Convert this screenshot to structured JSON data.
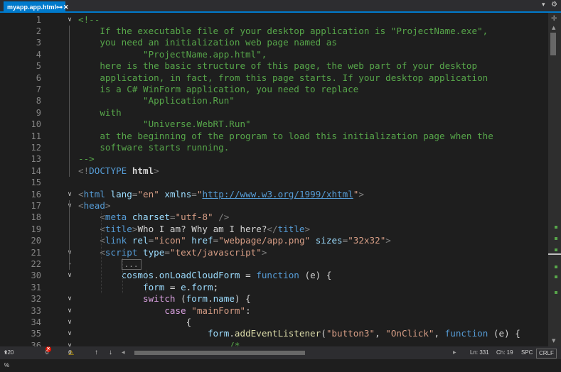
{
  "tab": {
    "title": "myapp.app.html",
    "pin_glyph": "⊶",
    "close_glyph": "✕"
  },
  "tabbar": {
    "dropdown_glyph": "▾",
    "settings_glyph": "⚙"
  },
  "editor": {
    "collapsed_placeholder": "...",
    "lines": [
      {
        "n": "1",
        "fold": "∨",
        "tokens": [
          {
            "t": "<!--",
            "c": "t-comment"
          }
        ]
      },
      {
        "n": "2",
        "tokens": [
          {
            "t": "    If the executable file of your desktop application is \"ProjectName.exe\",",
            "c": "t-comment"
          }
        ]
      },
      {
        "n": "3",
        "tokens": [
          {
            "t": "    you need an initialization web page named as",
            "c": "t-comment"
          }
        ]
      },
      {
        "n": "4",
        "tokens": [
          {
            "t": "            \"ProjectName.app.html\",",
            "c": "t-comment"
          }
        ]
      },
      {
        "n": "5",
        "tokens": [
          {
            "t": "    here is the basic structure of this page, the web part of your desktop",
            "c": "t-comment"
          }
        ]
      },
      {
        "n": "6",
        "tokens": [
          {
            "t": "    application, in fact, from this page starts. If your desktop application",
            "c": "t-comment"
          }
        ]
      },
      {
        "n": "7",
        "tokens": [
          {
            "t": "    is a C# WinForm application, you need to replace",
            "c": "t-comment"
          }
        ]
      },
      {
        "n": "8",
        "tokens": [
          {
            "t": "            \"Application.Run\"",
            "c": "t-comment"
          }
        ]
      },
      {
        "n": "9",
        "tokens": [
          {
            "t": "    with",
            "c": "t-comment"
          }
        ]
      },
      {
        "n": "10",
        "tokens": [
          {
            "t": "            \"Universe.WebRT.Run\"",
            "c": "t-comment"
          }
        ]
      },
      {
        "n": "11",
        "tokens": [
          {
            "t": "    at the beginning of the program to load this initialization page when the",
            "c": "t-comment"
          }
        ]
      },
      {
        "n": "12",
        "tokens": [
          {
            "t": "    software starts running.",
            "c": "t-comment"
          }
        ]
      },
      {
        "n": "13",
        "tokens": [
          {
            "t": "-->",
            "c": "t-comment"
          }
        ]
      },
      {
        "n": "14",
        "tokens": [
          {
            "t": "<!",
            "c": "t-punc"
          },
          {
            "t": "DOCTYPE",
            "c": "t-doctype"
          },
          {
            "t": " html",
            "c": "t-html"
          },
          {
            "t": ">",
            "c": "t-punc"
          }
        ]
      },
      {
        "n": "15",
        "tokens": []
      },
      {
        "n": "16",
        "fold": "∨",
        "tokens": [
          {
            "t": "<",
            "c": "t-punc"
          },
          {
            "t": "html",
            "c": "t-tag"
          },
          {
            "t": " lang",
            "c": "t-attr"
          },
          {
            "t": "=",
            "c": "t-punc"
          },
          {
            "t": "\"en\"",
            "c": "t-str"
          },
          {
            "t": " xmlns",
            "c": "t-attr"
          },
          {
            "t": "=",
            "c": "t-punc"
          },
          {
            "t": "\"",
            "c": "t-str"
          },
          {
            "t": "http://www.w3.org/1999/xhtml",
            "c": "t-url"
          },
          {
            "t": "\"",
            "c": "t-str"
          },
          {
            "t": ">",
            "c": "t-punc"
          }
        ]
      },
      {
        "n": "17",
        "fold": "∨",
        "tokens": [
          {
            "t": "<",
            "c": "t-punc"
          },
          {
            "t": "head",
            "c": "t-tag"
          },
          {
            "t": ">",
            "c": "t-punc"
          }
        ]
      },
      {
        "n": "18",
        "tokens": [
          {
            "t": "    <",
            "c": "t-punc"
          },
          {
            "t": "meta",
            "c": "t-tag"
          },
          {
            "t": " charset",
            "c": "t-attr"
          },
          {
            "t": "=",
            "c": "t-punc"
          },
          {
            "t": "\"utf-8\"",
            "c": "t-str"
          },
          {
            "t": " />",
            "c": "t-punc"
          }
        ]
      },
      {
        "n": "19",
        "tokens": [
          {
            "t": "    <",
            "c": "t-punc"
          },
          {
            "t": "title",
            "c": "t-tag"
          },
          {
            "t": ">",
            "c": "t-punc"
          },
          {
            "t": "Who I am? Why am I here?",
            "c": "t-txt"
          },
          {
            "t": "</",
            "c": "t-punc"
          },
          {
            "t": "title",
            "c": "t-tag"
          },
          {
            "t": ">",
            "c": "t-punc"
          }
        ]
      },
      {
        "n": "20",
        "tokens": [
          {
            "t": "    <",
            "c": "t-punc"
          },
          {
            "t": "link",
            "c": "t-tag"
          },
          {
            "t": " rel",
            "c": "t-attr"
          },
          {
            "t": "=",
            "c": "t-punc"
          },
          {
            "t": "\"icon\"",
            "c": "t-str"
          },
          {
            "t": " href",
            "c": "t-attr"
          },
          {
            "t": "=",
            "c": "t-punc"
          },
          {
            "t": "\"webpage/app.png\"",
            "c": "t-str"
          },
          {
            "t": " sizes",
            "c": "t-attr"
          },
          {
            "t": "=",
            "c": "t-punc"
          },
          {
            "t": "\"32x32\"",
            "c": "t-str"
          },
          {
            "t": ">",
            "c": "t-punc"
          }
        ]
      },
      {
        "n": "21",
        "fold": "∨",
        "tokens": [
          {
            "t": "    <",
            "c": "t-punc"
          },
          {
            "t": "script",
            "c": "t-tag"
          },
          {
            "t": " type",
            "c": "t-attr"
          },
          {
            "t": "=",
            "c": "t-punc"
          },
          {
            "t": "\"text/javascript\"",
            "c": "t-str"
          },
          {
            "t": ">",
            "c": "t-punc"
          }
        ]
      },
      {
        "n": "22",
        "fold": "›",
        "collapsed": true,
        "tokens": [
          {
            "t": "        ",
            "c": "t-txt"
          }
        ]
      },
      {
        "n": "30",
        "fold": "∨",
        "tokens": [
          {
            "t": "        cosmos",
            "c": "t-var"
          },
          {
            "t": ".",
            "c": "t-txt"
          },
          {
            "t": "onLoadCloudForm",
            "c": "t-var"
          },
          {
            "t": " = ",
            "c": "t-txt"
          },
          {
            "t": "function",
            "c": "t-kw"
          },
          {
            "t": " (e) {",
            "c": "t-txt"
          }
        ]
      },
      {
        "n": "31",
        "tokens": [
          {
            "t": "            form",
            "c": "t-var"
          },
          {
            "t": " = ",
            "c": "t-txt"
          },
          {
            "t": "e",
            "c": "t-var"
          },
          {
            "t": ".",
            "c": "t-txt"
          },
          {
            "t": "form",
            "c": "t-var"
          },
          {
            "t": ";",
            "c": "t-txt"
          }
        ]
      },
      {
        "n": "32",
        "fold": "∨",
        "tokens": [
          {
            "t": "            switch",
            "c": "t-ctrl"
          },
          {
            "t": " (",
            "c": "t-txt"
          },
          {
            "t": "form",
            "c": "t-var"
          },
          {
            "t": ".",
            "c": "t-txt"
          },
          {
            "t": "name",
            "c": "t-var"
          },
          {
            "t": ") {",
            "c": "t-txt"
          }
        ]
      },
      {
        "n": "33",
        "fold": "∨",
        "tokens": [
          {
            "t": "                case",
            "c": "t-ctrl"
          },
          {
            "t": " \"mainForm\"",
            "c": "t-str2"
          },
          {
            "t": ":",
            "c": "t-txt"
          }
        ]
      },
      {
        "n": "34",
        "fold": "∨",
        "tokens": [
          {
            "t": "                    {",
            "c": "t-txt"
          }
        ]
      },
      {
        "n": "35",
        "fold": "∨",
        "tokens": [
          {
            "t": "                        form",
            "c": "t-var"
          },
          {
            "t": ".",
            "c": "t-txt"
          },
          {
            "t": "addEventListener",
            "c": "t-fn"
          },
          {
            "t": "(",
            "c": "t-txt"
          },
          {
            "t": "\"button3\"",
            "c": "t-str2"
          },
          {
            "t": ", ",
            "c": "t-txt"
          },
          {
            "t": "\"OnClick\"",
            "c": "t-str2"
          },
          {
            "t": ", ",
            "c": "t-txt"
          },
          {
            "t": "function",
            "c": "t-kw"
          },
          {
            "t": " (e) {",
            "c": "t-txt"
          }
        ]
      },
      {
        "n": "36",
        "fold": "∨",
        "tokens": [
          {
            "t": "                            /*",
            "c": "t-comment"
          }
        ]
      }
    ]
  },
  "statusbar": {
    "zoom": "120 %",
    "zoom_caret": "▾",
    "errors": "0",
    "warnings": "6",
    "up_glyph": "↑",
    "down_glyph": "↓",
    "line": "Ln: 331",
    "col": "Ch: 19",
    "whitespace": "SPC",
    "eol": "CRLF"
  },
  "colors": {
    "accent": "#007acc",
    "comment": "#57a64a",
    "tag": "#569cd6",
    "attr": "#9cdcfe",
    "string": "#d69d85",
    "control": "#d8a0df",
    "function": "#dcdcaa"
  }
}
